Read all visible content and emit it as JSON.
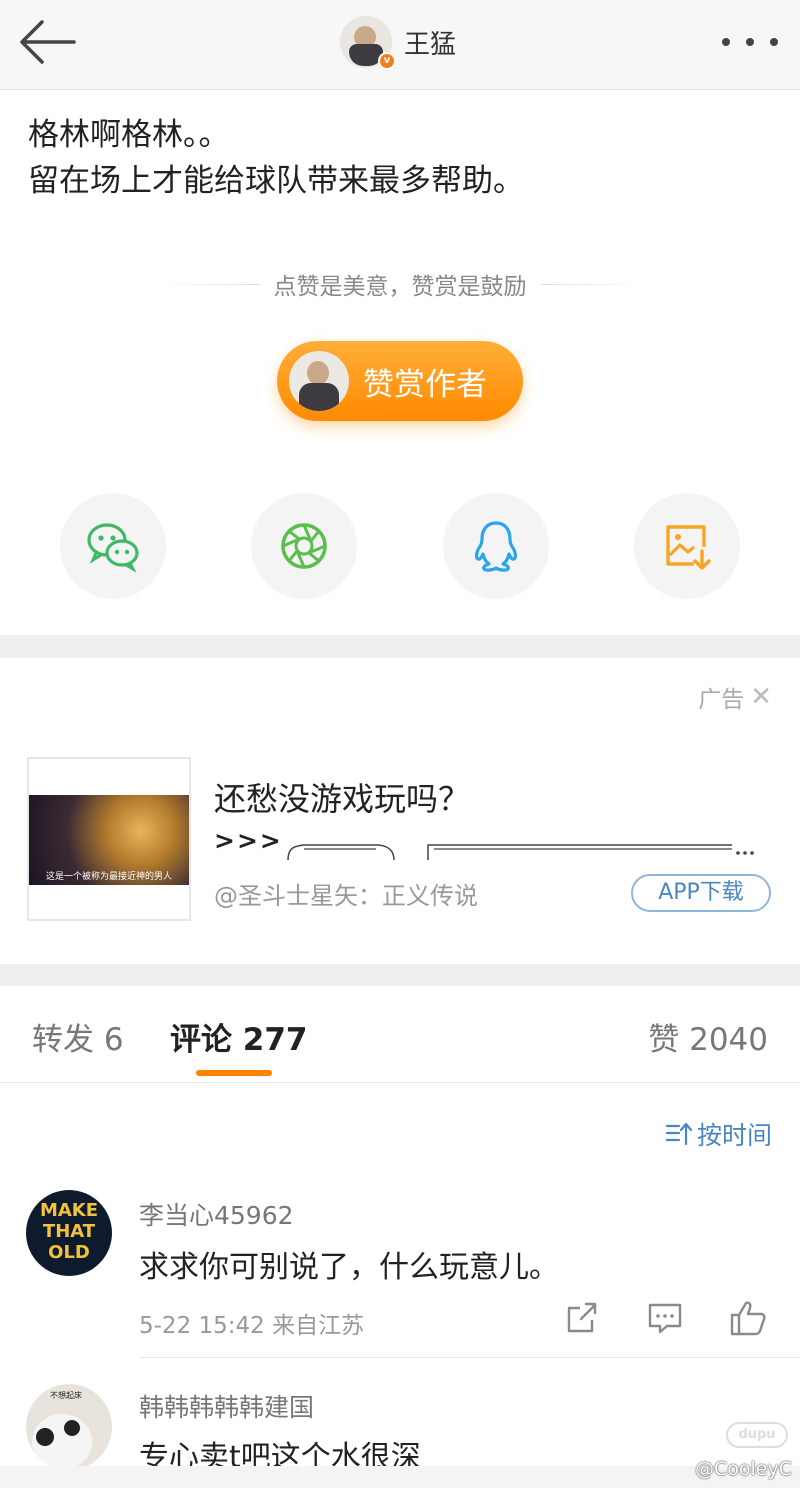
{
  "header": {
    "author_name": "王猛",
    "verified_badge": "v"
  },
  "post": {
    "line1": "格林啊格林。。",
    "line2": "留在场上才能给球队带来最多帮助。"
  },
  "reward": {
    "slogan": "点赞是美意，赞赏是鼓励",
    "button_label": "赞赏作者"
  },
  "share": {
    "icons": [
      "wechat-icon",
      "moments-icon",
      "qq-icon",
      "save-image-icon"
    ],
    "colors": {
      "wechat": "#3fb968",
      "moments": "#58c04a",
      "qq": "#2aa5e8",
      "save": "#f5a623"
    }
  },
  "ad": {
    "label": "广告",
    "close": "✕",
    "title": "还愁没游戏玩吗？",
    "arrows": ">>>",
    "source": "@圣斗士星矢：正义传说",
    "button": "APP下载",
    "thumb_caption": "这是一个被称为最接近神的男人"
  },
  "tabs": {
    "repost": "转发 6",
    "comments": "评论 277",
    "likes": "赞 2040"
  },
  "sort": {
    "label": "按时间"
  },
  "comments": [
    {
      "user": "李当心45962",
      "text": "求求你可别说了，什么玩意儿。",
      "meta": "5-22 15:42  来自江苏",
      "avatar_text": [
        "MAKE",
        "THAT",
        "OLD"
      ]
    },
    {
      "user": "韩韩韩韩韩建国",
      "text": "专心卖t吧这个水很深",
      "avatar_text": "不想起床"
    }
  ],
  "watermark": {
    "logo": "dupu",
    "text": "@CooleyC"
  },
  "colors": {
    "accent": "#ff8200",
    "link": "#4b86c4"
  }
}
